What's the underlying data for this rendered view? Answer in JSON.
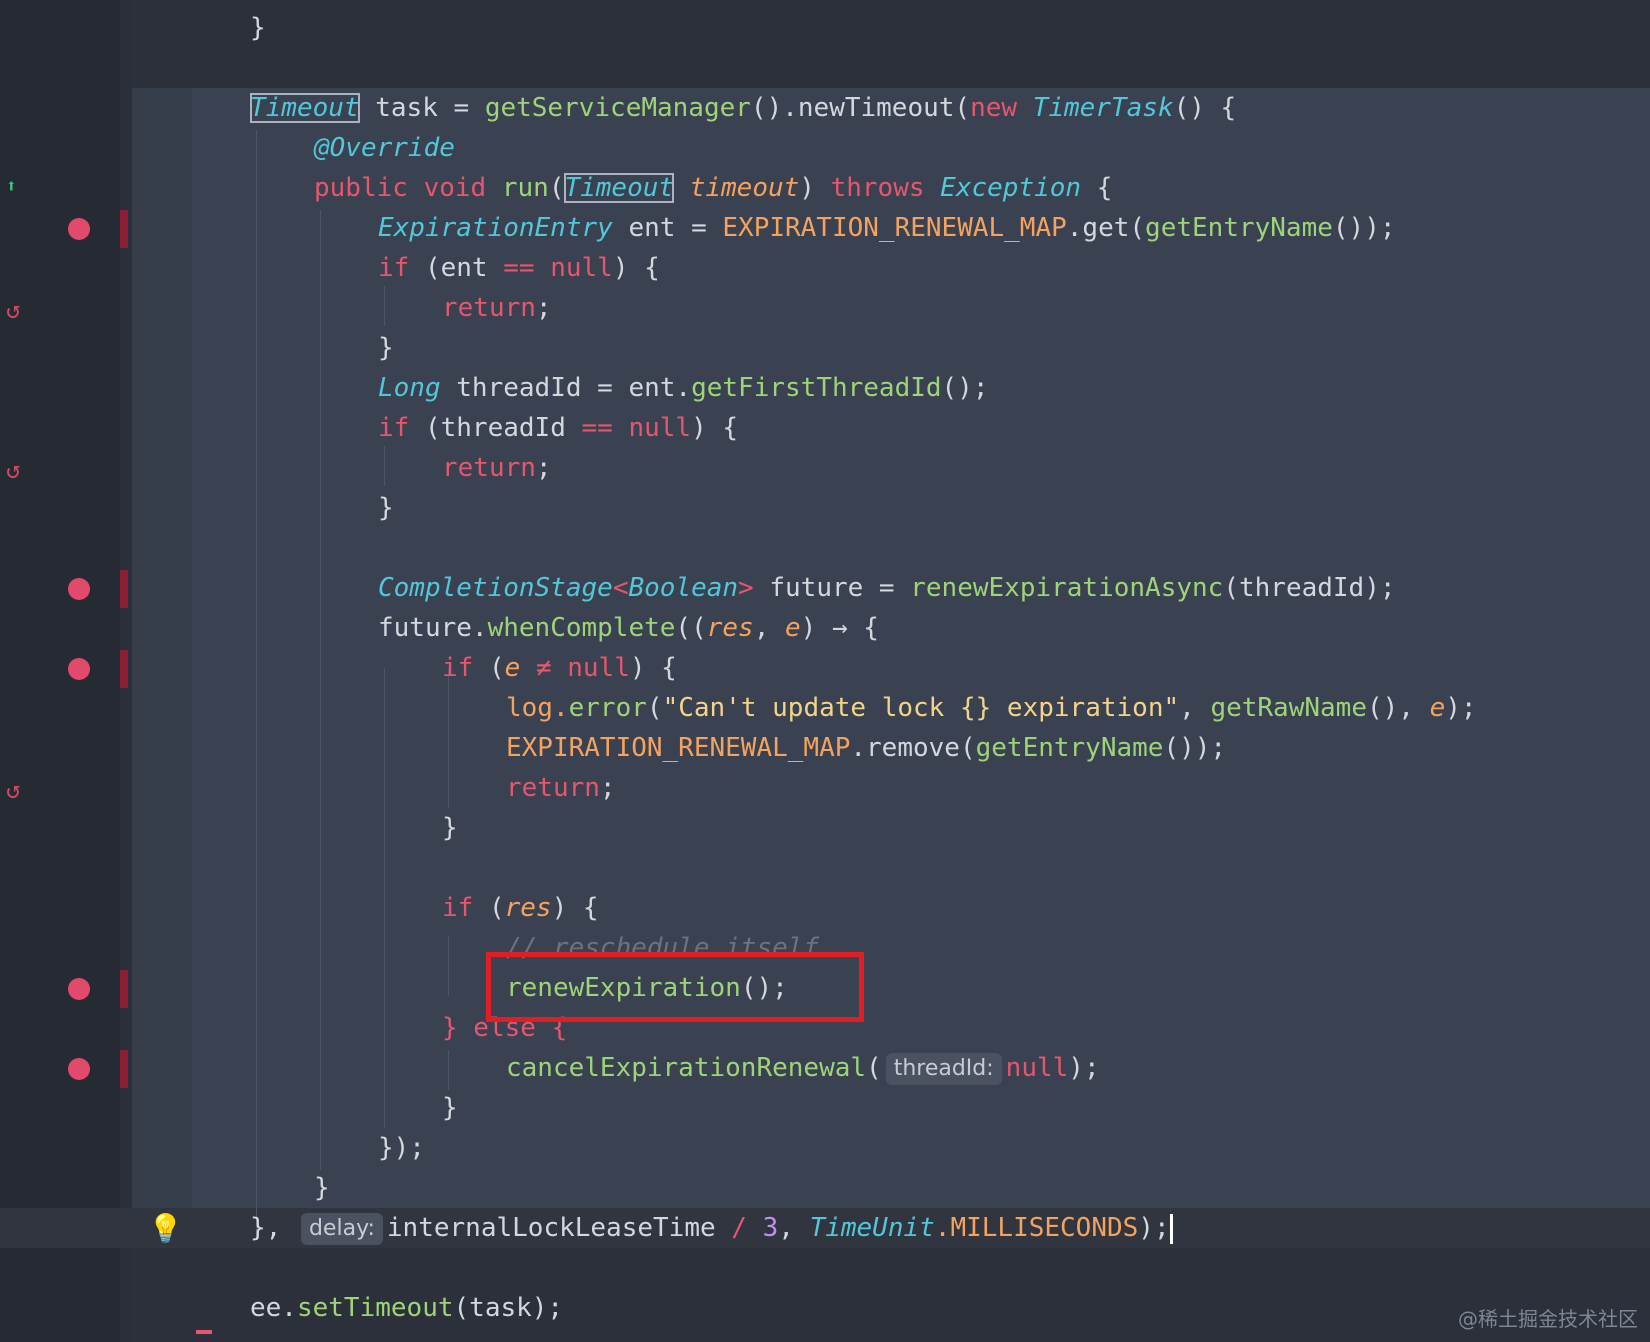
{
  "editor": {
    "colors": {
      "background": "#2b303b",
      "gutter": "#262a33",
      "lambda_block": "#3a4150",
      "keyword": "#e5566f",
      "type": "#52c7d8",
      "method": "#9ed37a",
      "constant": "#f3a35f",
      "string": "#f3d48a",
      "number": "#c28ef0",
      "highlight_box": "#e01e24",
      "breakpoint": "#e24a6d"
    },
    "icons": {
      "override_gutter": "override-arrow-up-icon",
      "recursive_call": "recursive-call-icon",
      "breakpoint": "breakpoint-dot-icon",
      "intention": "lightbulb-icon"
    },
    "tokens": {
      "brace_close": "}",
      "brace_open": "{",
      "timeout_type": "Timeout",
      "task_var": " task = ",
      "get_service_manager": "getServiceManager",
      "new_timeout": ".newTimeout(",
      "new_kw": "new ",
      "timer_task": "TimerTask",
      "parens_brace": "() {",
      "override_ann": "@Override",
      "public_void": "public void ",
      "run": "run",
      "open_paren": "(",
      "timeout_param": "timeout",
      "throws_kw": "throws ",
      "exception_type": "Exception",
      "close_paren_brace": ") {",
      "expiration_entry": "ExpirationEntry",
      "ent_assign": " ent = ",
      "renewal_map": "EXPIRATION_RENEWAL_MAP",
      "dot_get": ".get(",
      "get_entry_name": "getEntryName",
      "close_get": "());",
      "if_kw": "if",
      "ent_cmp": " (ent ",
      "eq_op": "==",
      "null_kw": "null",
      "return_kw": "return",
      "semicolon": ";",
      "long_type": "Long",
      "thread_id_assign": " threadId = ent.",
      "get_first_thread_id": "getFirstThreadId",
      "call_end": "();",
      "thread_id_cmp": " (threadId ",
      "completion_stage": "CompletionStage",
      "lt": "<",
      "boolean_type": "Boolean",
      "gt": ">",
      "future_assign": " future = ",
      "renew_async": "renewExpirationAsync",
      "thread_id_arg": "(threadId);",
      "future_dot": "future.",
      "when_complete": "whenComplete",
      "double_paren": "((",
      "res": "res",
      "comma_space": ", ",
      "e": "e",
      "arrow": ") → {",
      "neq_op": "≠",
      "log_error": "log.",
      "error": "error",
      "log_message": "\"Can't update lock {} expiration\"",
      "get_raw_name": "getRawName",
      "call_comma": "(), ",
      "close_call": ");",
      "dot_remove": ".remove(",
      "comment_reschedule": "// reschedule itself",
      "renew_expiration": "renewExpiration",
      "else_line": "} else {",
      "cancel_renewal": "cancelExpirationRenewal",
      "hint_thread_id": "threadId:",
      "lambda_close": "});",
      "outer_close": "},",
      "hint_delay": "delay:",
      "lease_time": "internalLockLeaseTime ",
      "div": "/",
      "three": "3",
      "time_unit": "TimeUnit",
      "milliseconds": ".MILLISECONDS",
      "ee_set": "ee.",
      "set_timeout": "setTimeout",
      "task_arg": "(task);"
    }
  },
  "watermark": "@稀土掘金技术社区"
}
